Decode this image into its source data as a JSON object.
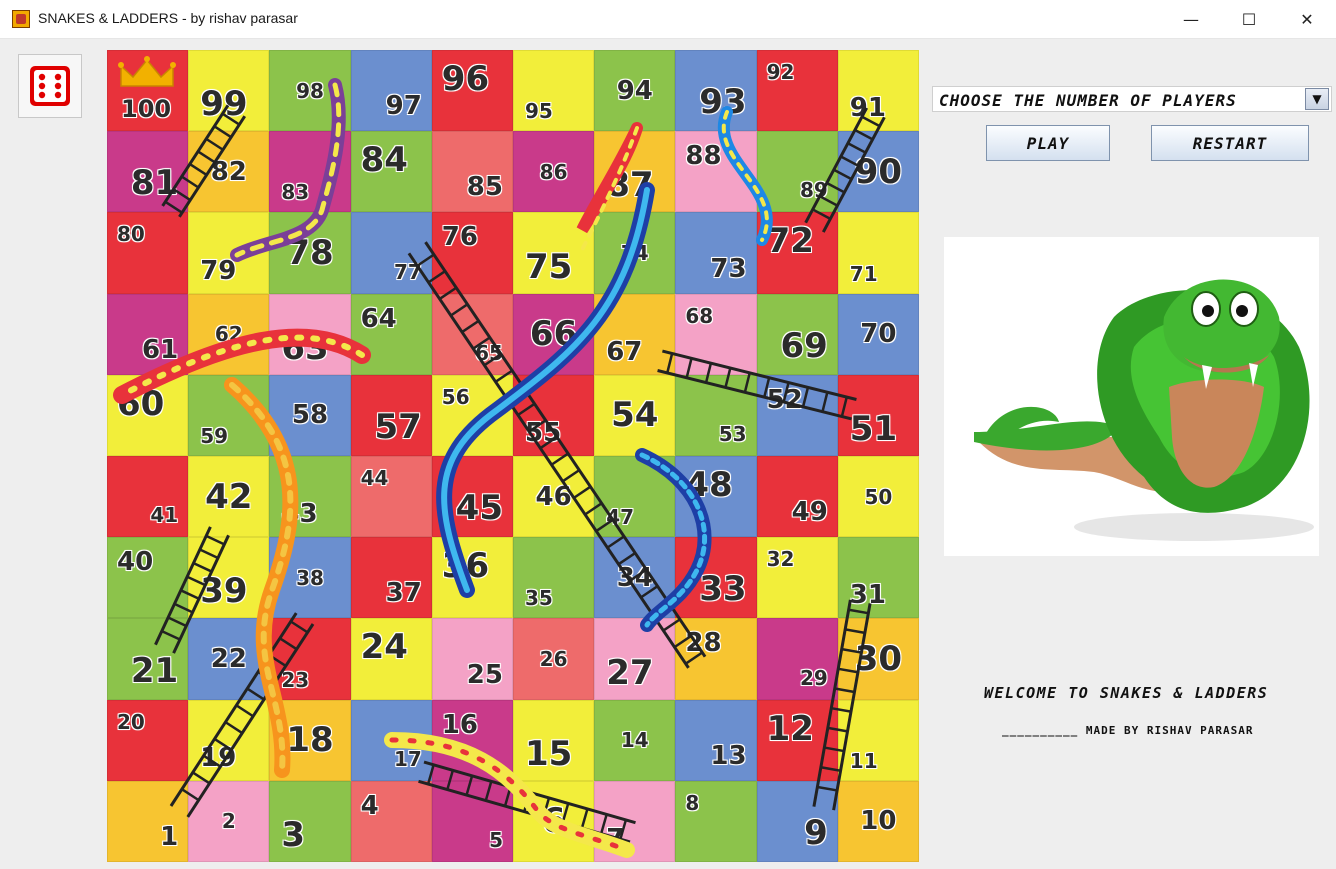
{
  "window": {
    "title": "SNAKES & LADDERS - by rishav parasar",
    "minimize_glyph": "—",
    "maximize_glyph": "☐",
    "close_glyph": "✕"
  },
  "dice": {
    "icon": "dice-six-icon",
    "face": 6,
    "color": "#e00000"
  },
  "board": {
    "cells": [
      100,
      99,
      98,
      97,
      96,
      95,
      94,
      93,
      92,
      91,
      81,
      82,
      83,
      84,
      85,
      86,
      87,
      88,
      89,
      90,
      80,
      79,
      78,
      77,
      76,
      75,
      74,
      73,
      72,
      71,
      61,
      62,
      63,
      64,
      65,
      66,
      67,
      68,
      69,
      70,
      60,
      59,
      58,
      57,
      56,
      55,
      54,
      53,
      52,
      51,
      41,
      42,
      43,
      44,
      45,
      46,
      47,
      48,
      49,
      50,
      40,
      39,
      38,
      37,
      36,
      35,
      34,
      33,
      32,
      31,
      21,
      22,
      23,
      24,
      25,
      26,
      27,
      28,
      29,
      30,
      20,
      19,
      18,
      17,
      16,
      15,
      14,
      13,
      12,
      11,
      1,
      2,
      3,
      4,
      5,
      6,
      7,
      8,
      9,
      10
    ],
    "colors": {
      "1": "#f7c531",
      "2": "#f4a2c6",
      "3": "#8cc34b",
      "4": "#ee6b6b",
      "5": "#c93a8a",
      "6": "#f2ee3a",
      "7": "#f4a2c6",
      "8": "#8cc34b",
      "9": "#6b8fcf",
      "10": "#f7c531",
      "11": "#f2ee3a",
      "12": "#e8323b",
      "13": "#6b8fcf",
      "14": "#8cc34b",
      "15": "#f2ee3a",
      "16": "#c93a8a",
      "17": "#6b8fcf",
      "18": "#f7c531",
      "19": "#f2ee3a",
      "20": "#e8323b",
      "21": "#8cc34b",
      "22": "#6b8fcf",
      "23": "#e8323b",
      "24": "#f2ee3a",
      "25": "#f4a2c6",
      "26": "#ee6b6b",
      "27": "#f4a2c6",
      "28": "#f7c531",
      "29": "#c93a8a",
      "30": "#f7c531",
      "31": "#8cc34b",
      "32": "#f2ee3a",
      "33": "#e8323b",
      "34": "#6b8fcf",
      "35": "#8cc34b",
      "36": "#f2ee3a",
      "37": "#e8323b",
      "38": "#6b8fcf",
      "39": "#f2ee3a",
      "40": "#8cc34b",
      "41": "#e8323b",
      "42": "#f2ee3a",
      "43": "#8cc34b",
      "44": "#ee6b6b",
      "45": "#e8323b",
      "46": "#f2ee3a",
      "47": "#8cc34b",
      "48": "#6b8fcf",
      "49": "#e8323b",
      "50": "#f2ee3a",
      "51": "#e8323b",
      "52": "#6b8fcf",
      "53": "#8cc34b",
      "54": "#f2ee3a",
      "55": "#e8323b",
      "56": "#f2ee3a",
      "57": "#e8323b",
      "58": "#6b8fcf",
      "59": "#8cc34b",
      "60": "#f2ee3a",
      "61": "#c93a8a",
      "62": "#f7c531",
      "63": "#f4a2c6",
      "64": "#8cc34b",
      "65": "#ee6b6b",
      "66": "#c93a8a",
      "67": "#f7c531",
      "68": "#f4a2c6",
      "69": "#8cc34b",
      "70": "#6b8fcf",
      "71": "#f2ee3a",
      "72": "#e8323b",
      "73": "#6b8fcf",
      "74": "#8cc34b",
      "75": "#f2ee3a",
      "76": "#e8323b",
      "77": "#6b8fcf",
      "78": "#8cc34b",
      "79": "#f2ee3a",
      "80": "#e8323b",
      "81": "#c93a8a",
      "82": "#f7c531",
      "83": "#c93a8a",
      "84": "#8cc34b",
      "85": "#ee6b6b",
      "86": "#c93a8a",
      "87": "#f7c531",
      "88": "#f4a2c6",
      "89": "#8cc34b",
      "90": "#6b8fcf",
      "91": "#f2ee3a",
      "92": "#e8323b",
      "93": "#6b8fcf",
      "94": "#8cc34b",
      "95": "#f2ee3a",
      "96": "#e8323b",
      "97": "#6b8fcf",
      "98": "#8cc34b",
      "99": "#f2ee3a",
      "100": "#e8323b"
    }
  },
  "controls": {
    "players_label": "CHOOSE THE NUMBER OF PLAYERS",
    "dropdown_arrow": "▼",
    "play_label": "PLAY",
    "restart_label": "RESTART"
  },
  "footer": {
    "welcome": "WELCOME TO SNAKES & LADDERS",
    "credit": "__________ MADE BY RISHAV PARASAR"
  },
  "image": {
    "icon": "cartoon-snake-image"
  }
}
